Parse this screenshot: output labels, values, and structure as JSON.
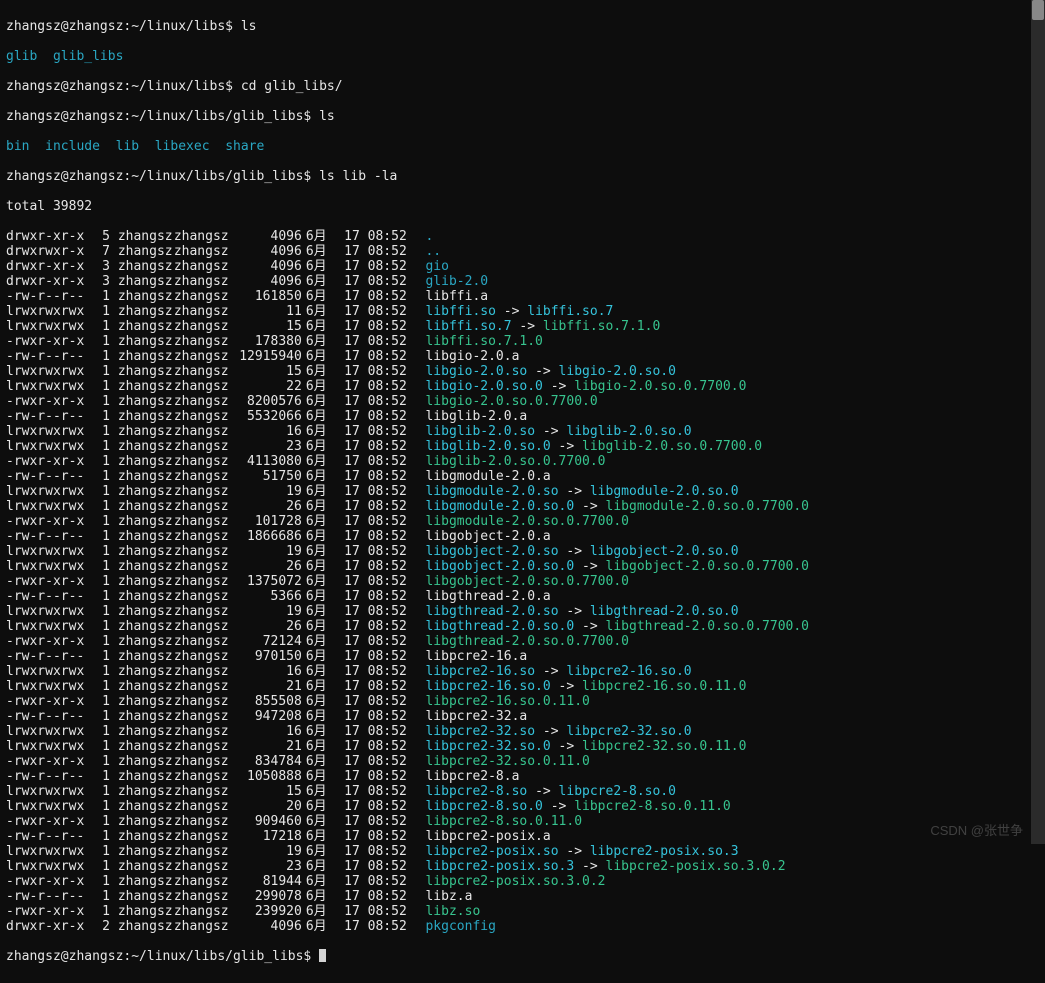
{
  "watermark": "CSDN @张世争",
  "prompts": {
    "p1_user": "zhangsz@zhangsz",
    "p1_path": "~/linux/libs",
    "p1_cmd": "ls",
    "p1_out": [
      "glib",
      "glib_libs"
    ],
    "p2_cmd": "cd glib_libs/",
    "p3_path": "~/linux/libs/glib_libs",
    "p3_cmd": "ls",
    "p3_out": [
      "bin",
      "include",
      "lib",
      "libexec",
      "share"
    ],
    "p4_cmd": "ls lib -la",
    "total": "total 39892"
  },
  "cols": {
    "month": "6月",
    "day": "17",
    "time": "08:52",
    "owner": "zhangsz"
  },
  "rows": [
    {
      "perm": "drwxr-xr-x",
      "lnk": "5",
      "size": "4096",
      "name": ".",
      "cls": "dircy"
    },
    {
      "perm": "drwxrwxr-x",
      "lnk": "7",
      "size": "4096",
      "name": "..",
      "cls": "dircy"
    },
    {
      "perm": "drwxr-xr-x",
      "lnk": "3",
      "size": "4096",
      "name": "gio",
      "cls": "dircy"
    },
    {
      "perm": "drwxr-xr-x",
      "lnk": "3",
      "size": "4096",
      "name": "glib-2.0",
      "cls": "dircy"
    },
    {
      "perm": "-rw-r--r--",
      "lnk": "1",
      "size": "161850",
      "name": "libffi.a",
      "cls": "white"
    },
    {
      "perm": "lrwxrwxrwx",
      "lnk": "1",
      "size": "11",
      "name": "libffi.so",
      "target": "libffi.so.7",
      "cls": "bcyan",
      "tcls": "bcyan"
    },
    {
      "perm": "lrwxrwxrwx",
      "lnk": "1",
      "size": "15",
      "name": "libffi.so.7",
      "target": "libffi.so.7.1.0",
      "cls": "bcyan",
      "tcls": "green"
    },
    {
      "perm": "-rwxr-xr-x",
      "lnk": "1",
      "size": "178380",
      "name": "libffi.so.7.1.0",
      "cls": "green"
    },
    {
      "perm": "-rw-r--r--",
      "lnk": "1",
      "size": "12915940",
      "name": "libgio-2.0.a",
      "cls": "white"
    },
    {
      "perm": "lrwxrwxrwx",
      "lnk": "1",
      "size": "15",
      "name": "libgio-2.0.so",
      "target": "libgio-2.0.so.0",
      "cls": "bcyan",
      "tcls": "bcyan"
    },
    {
      "perm": "lrwxrwxrwx",
      "lnk": "1",
      "size": "22",
      "name": "libgio-2.0.so.0",
      "target": "libgio-2.0.so.0.7700.0",
      "cls": "bcyan",
      "tcls": "green"
    },
    {
      "perm": "-rwxr-xr-x",
      "lnk": "1",
      "size": "8200576",
      "name": "libgio-2.0.so.0.7700.0",
      "cls": "green"
    },
    {
      "perm": "-rw-r--r--",
      "lnk": "1",
      "size": "5532066",
      "name": "libglib-2.0.a",
      "cls": "white"
    },
    {
      "perm": "lrwxrwxrwx",
      "lnk": "1",
      "size": "16",
      "name": "libglib-2.0.so",
      "target": "libglib-2.0.so.0",
      "cls": "bcyan",
      "tcls": "bcyan"
    },
    {
      "perm": "lrwxrwxrwx",
      "lnk": "1",
      "size": "23",
      "name": "libglib-2.0.so.0",
      "target": "libglib-2.0.so.0.7700.0",
      "cls": "bcyan",
      "tcls": "green"
    },
    {
      "perm": "-rwxr-xr-x",
      "lnk": "1",
      "size": "4113080",
      "name": "libglib-2.0.so.0.7700.0",
      "cls": "green"
    },
    {
      "perm": "-rw-r--r--",
      "lnk": "1",
      "size": "51750",
      "name": "libgmodule-2.0.a",
      "cls": "white"
    },
    {
      "perm": "lrwxrwxrwx",
      "lnk": "1",
      "size": "19",
      "name": "libgmodule-2.0.so",
      "target": "libgmodule-2.0.so.0",
      "cls": "bcyan",
      "tcls": "bcyan"
    },
    {
      "perm": "lrwxrwxrwx",
      "lnk": "1",
      "size": "26",
      "name": "libgmodule-2.0.so.0",
      "target": "libgmodule-2.0.so.0.7700.0",
      "cls": "bcyan",
      "tcls": "green"
    },
    {
      "perm": "-rwxr-xr-x",
      "lnk": "1",
      "size": "101728",
      "name": "libgmodule-2.0.so.0.7700.0",
      "cls": "green"
    },
    {
      "perm": "-rw-r--r--",
      "lnk": "1",
      "size": "1866686",
      "name": "libgobject-2.0.a",
      "cls": "white"
    },
    {
      "perm": "lrwxrwxrwx",
      "lnk": "1",
      "size": "19",
      "name": "libgobject-2.0.so",
      "target": "libgobject-2.0.so.0",
      "cls": "bcyan",
      "tcls": "bcyan"
    },
    {
      "perm": "lrwxrwxrwx",
      "lnk": "1",
      "size": "26",
      "name": "libgobject-2.0.so.0",
      "target": "libgobject-2.0.so.0.7700.0",
      "cls": "bcyan",
      "tcls": "green"
    },
    {
      "perm": "-rwxr-xr-x",
      "lnk": "1",
      "size": "1375072",
      "name": "libgobject-2.0.so.0.7700.0",
      "cls": "green"
    },
    {
      "perm": "-rw-r--r--",
      "lnk": "1",
      "size": "5366",
      "name": "libgthread-2.0.a",
      "cls": "white"
    },
    {
      "perm": "lrwxrwxrwx",
      "lnk": "1",
      "size": "19",
      "name": "libgthread-2.0.so",
      "target": "libgthread-2.0.so.0",
      "cls": "bcyan",
      "tcls": "bcyan"
    },
    {
      "perm": "lrwxrwxrwx",
      "lnk": "1",
      "size": "26",
      "name": "libgthread-2.0.so.0",
      "target": "libgthread-2.0.so.0.7700.0",
      "cls": "bcyan",
      "tcls": "green"
    },
    {
      "perm": "-rwxr-xr-x",
      "lnk": "1",
      "size": "72124",
      "name": "libgthread-2.0.so.0.7700.0",
      "cls": "green"
    },
    {
      "perm": "-rw-r--r--",
      "lnk": "1",
      "size": "970150",
      "name": "libpcre2-16.a",
      "cls": "white"
    },
    {
      "perm": "lrwxrwxrwx",
      "lnk": "1",
      "size": "16",
      "name": "libpcre2-16.so",
      "target": "libpcre2-16.so.0",
      "cls": "bcyan",
      "tcls": "bcyan"
    },
    {
      "perm": "lrwxrwxrwx",
      "lnk": "1",
      "size": "21",
      "name": "libpcre2-16.so.0",
      "target": "libpcre2-16.so.0.11.0",
      "cls": "bcyan",
      "tcls": "green"
    },
    {
      "perm": "-rwxr-xr-x",
      "lnk": "1",
      "size": "855508",
      "name": "libpcre2-16.so.0.11.0",
      "cls": "green"
    },
    {
      "perm": "-rw-r--r--",
      "lnk": "1",
      "size": "947208",
      "name": "libpcre2-32.a",
      "cls": "white"
    },
    {
      "perm": "lrwxrwxrwx",
      "lnk": "1",
      "size": "16",
      "name": "libpcre2-32.so",
      "target": "libpcre2-32.so.0",
      "cls": "bcyan",
      "tcls": "bcyan"
    },
    {
      "perm": "lrwxrwxrwx",
      "lnk": "1",
      "size": "21",
      "name": "libpcre2-32.so.0",
      "target": "libpcre2-32.so.0.11.0",
      "cls": "bcyan",
      "tcls": "green"
    },
    {
      "perm": "-rwxr-xr-x",
      "lnk": "1",
      "size": "834784",
      "name": "libpcre2-32.so.0.11.0",
      "cls": "green"
    },
    {
      "perm": "-rw-r--r--",
      "lnk": "1",
      "size": "1050888",
      "name": "libpcre2-8.a",
      "cls": "white"
    },
    {
      "perm": "lrwxrwxrwx",
      "lnk": "1",
      "size": "15",
      "name": "libpcre2-8.so",
      "target": "libpcre2-8.so.0",
      "cls": "bcyan",
      "tcls": "bcyan"
    },
    {
      "perm": "lrwxrwxrwx",
      "lnk": "1",
      "size": "20",
      "name": "libpcre2-8.so.0",
      "target": "libpcre2-8.so.0.11.0",
      "cls": "bcyan",
      "tcls": "green"
    },
    {
      "perm": "-rwxr-xr-x",
      "lnk": "1",
      "size": "909460",
      "name": "libpcre2-8.so.0.11.0",
      "cls": "green"
    },
    {
      "perm": "-rw-r--r--",
      "lnk": "1",
      "size": "17218",
      "name": "libpcre2-posix.a",
      "cls": "white"
    },
    {
      "perm": "lrwxrwxrwx",
      "lnk": "1",
      "size": "19",
      "name": "libpcre2-posix.so",
      "target": "libpcre2-posix.so.3",
      "cls": "bcyan",
      "tcls": "bcyan"
    },
    {
      "perm": "lrwxrwxrwx",
      "lnk": "1",
      "size": "23",
      "name": "libpcre2-posix.so.3",
      "target": "libpcre2-posix.so.3.0.2",
      "cls": "bcyan",
      "tcls": "green"
    },
    {
      "perm": "-rwxr-xr-x",
      "lnk": "1",
      "size": "81944",
      "name": "libpcre2-posix.so.3.0.2",
      "cls": "green"
    },
    {
      "perm": "-rw-r--r--",
      "lnk": "1",
      "size": "299078",
      "name": "libz.a",
      "cls": "white"
    },
    {
      "perm": "-rwxr-xr-x",
      "lnk": "1",
      "size": "239920",
      "name": "libz.so",
      "cls": "green"
    },
    {
      "perm": "drwxr-xr-x",
      "lnk": "2",
      "size": "4096",
      "name": "pkgconfig",
      "cls": "dircy"
    }
  ]
}
